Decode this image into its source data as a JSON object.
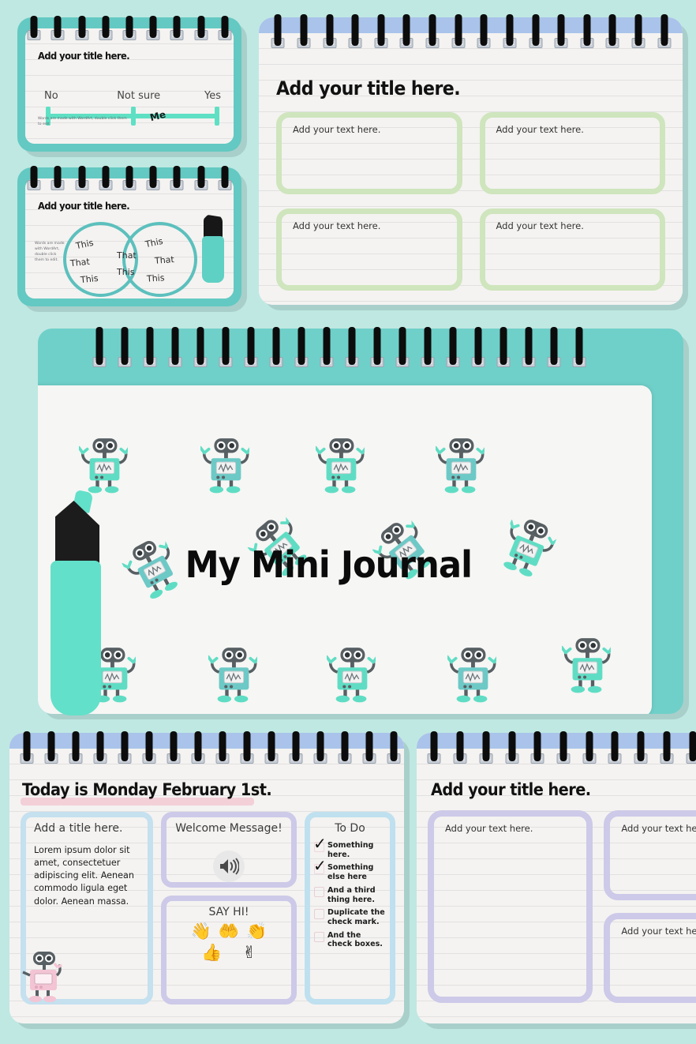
{
  "theme": {
    "background": "#bfe8e2",
    "teal": "#63c9c2",
    "mint": "#5fe0c4",
    "paper": "#f4f3f1",
    "blue_band": "#a9c3ea",
    "green_border": "#cfe5bd",
    "purple_border": "#cdc9e8",
    "lightblue_border": "#c5e0ef",
    "pink_stroke": "#f2c8d4",
    "robot_mint": "#5fddc4",
    "robot_teal": "#6cc9c6",
    "robot_gray": "#575f63",
    "robot_pink": "#f3c4d4"
  },
  "scale_card": {
    "title": "Add your title here.",
    "labels": [
      "No",
      "Not sure",
      "Yes"
    ],
    "marker_label": "Me",
    "marker_position_pct": 62,
    "note": "Words are made with WordArt, double click them to edit"
  },
  "venn_card": {
    "title": "Add your title here.",
    "note": "Words are made with WordArt, double click them to edit.",
    "left_words": [
      "This",
      "That",
      "This"
    ],
    "center_words": [
      "That",
      "This"
    ],
    "right_words": [
      "This",
      "That",
      "This"
    ],
    "marker_icon": "highlighter-icon"
  },
  "four_box_card": {
    "title": "Add your title here.",
    "boxes": [
      {
        "placeholder": "Add your text here."
      },
      {
        "placeholder": "Add your text here."
      },
      {
        "placeholder": "Add your text here."
      },
      {
        "placeholder": "Add your text here."
      }
    ]
  },
  "journal_card": {
    "title": "My Mini Journal",
    "marker_icon": "highlighter-icon",
    "robot_icon": "robot-icon",
    "robot_count": 13
  },
  "today_card": {
    "title": "Today is Monday February 1st.",
    "left_pane": {
      "title": "Add a title here.",
      "body": "Lorem ipsum dolor sit amet, consectetuer adipiscing elit. Aenean commodo ligula eget dolor. Aenean massa.",
      "robot_icon": "pink-robot-icon"
    },
    "welcome_pane": {
      "title": "Welcome Message!",
      "icon": "speaker-icon"
    },
    "sayhi_pane": {
      "title": "SAY HI!",
      "icons": [
        {
          "name": "waving-hand-icon",
          "glyph": "👋"
        },
        {
          "name": "open-hands-icon",
          "glyph": "🤲"
        },
        {
          "name": "clapping-hands-icon",
          "glyph": "👏"
        },
        {
          "name": "thumbs-up-icon",
          "glyph": "👍"
        },
        {
          "name": "peace-sign-icon",
          "glyph": "✌"
        }
      ]
    },
    "todo_pane": {
      "title": "To Do",
      "items": [
        {
          "text": "Something here.",
          "checked": true
        },
        {
          "text": "Something else here",
          "checked": true
        },
        {
          "text": "And a third thing here.",
          "checked": false
        },
        {
          "text": "Duplicate the check mark.",
          "checked": false
        },
        {
          "text": "And the check boxes.",
          "checked": false
        }
      ]
    }
  },
  "right_card": {
    "title": "Add your title here.",
    "boxes": [
      {
        "placeholder": "Add your text here."
      },
      {
        "placeholder": "Add your text here."
      },
      {
        "placeholder": "Add your text here."
      }
    ]
  }
}
